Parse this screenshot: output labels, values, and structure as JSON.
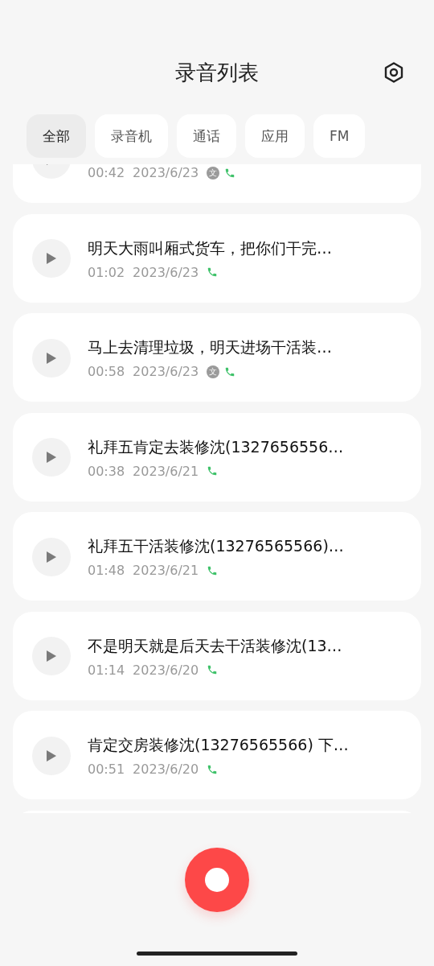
{
  "header": {
    "title": "录音列表"
  },
  "tabs": [
    {
      "label": "全部",
      "selected": true
    },
    {
      "label": "录音机",
      "selected": false
    },
    {
      "label": "通话",
      "selected": false
    },
    {
      "label": "应用",
      "selected": false
    },
    {
      "label": "FM",
      "selected": false
    }
  ],
  "recordings": [
    {
      "duration": "00:42",
      "date": "2023/6/23",
      "transcript_badge": "文",
      "call": true
    },
    {
      "title": "明天大雨叫厢式货车，把你们干完…",
      "duration": "01:02",
      "date": "2023/6/23",
      "call": true
    },
    {
      "title": "马上去清理垃圾，明天进场干活装…",
      "duration": "00:58",
      "date": "2023/6/23",
      "transcript_badge": "文",
      "call": true
    },
    {
      "title": "礼拜五肯定去装修沈(1327656556…",
      "duration": "00:38",
      "date": "2023/6/21",
      "call": true
    },
    {
      "title": "礼拜五干活装修沈(13276565566)…",
      "duration": "01:48",
      "date": "2023/6/21",
      "call": true
    },
    {
      "title": "不是明天就是后天去干活装修沈(13…",
      "duration": "01:14",
      "date": "2023/6/20",
      "call": true
    },
    {
      "title": "肯定交房装修沈(13276565566) 下…",
      "duration": "00:51",
      "date": "2023/6/20",
      "call": true
    }
  ]
}
